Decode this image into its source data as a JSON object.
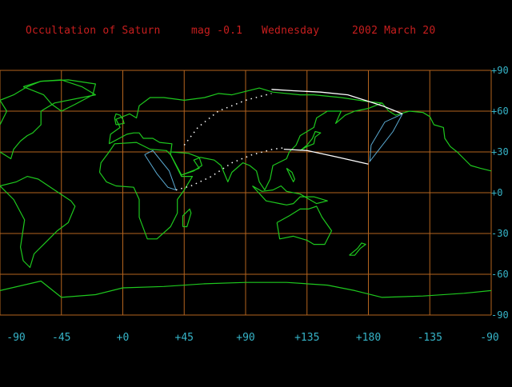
{
  "header": {
    "event": "Occultation of Saturn",
    "magnitude": "mag -0.1",
    "weekday": "Wednesday",
    "date": "2002 March 20"
  },
  "axes": {
    "lat_labels": [
      "+90",
      "+60",
      "+30",
      "+0",
      "-30",
      "-60",
      "-90"
    ],
    "lon_labels": [
      "-90",
      "-45",
      "+0",
      "+45",
      "+90",
      "+135",
      "+180",
      "-135",
      "-90"
    ]
  },
  "colors": {
    "background": "#000000",
    "grid": "#b4641e",
    "coast": "#1ec81e",
    "title": "#c81e1e",
    "labels": "#36b4c8",
    "path": "#ffffff",
    "region": "#5aaad2"
  },
  "map_data": {
    "projection": "equirectangular",
    "lon_range": [
      -90,
      270
    ],
    "lat_range": [
      -90,
      90
    ],
    "grid_step_lon": 45,
    "grid_step_lat": 30,
    "occultation_limits": {
      "northern_limit": [
        [
          109,
          76
        ],
        [
          125,
          75
        ],
        [
          145,
          74
        ],
        [
          165,
          72
        ],
        [
          190,
          64
        ],
        [
          205,
          58
        ]
      ],
      "southern_limit": [
        [
          118,
          32
        ],
        [
          135,
          31
        ],
        [
          158,
          26
        ],
        [
          180,
          21
        ]
      ],
      "night_portion": [
        [
          39,
          2
        ],
        [
          50,
          5
        ],
        [
          65,
          12
        ],
        [
          80,
          22
        ],
        [
          95,
          28
        ],
        [
          110,
          32
        ],
        [
          118,
          33
        ]
      ],
      "night_north": [
        [
          45,
          35
        ],
        [
          55,
          48
        ],
        [
          70,
          60
        ],
        [
          90,
          68
        ],
        [
          109,
          73
        ]
      ]
    },
    "visibility_region": [
      [
        205,
        58
      ],
      [
        198,
        45
      ],
      [
        188,
        32
      ],
      [
        181,
        23
      ],
      [
        182,
        35
      ],
      [
        192,
        52
      ],
      [
        205,
        58
      ]
    ],
    "west_region": [
      [
        16,
        28
      ],
      [
        25,
        14
      ],
      [
        33,
        4
      ],
      [
        39,
        2
      ],
      [
        34,
        16
      ],
      [
        22,
        31
      ],
      [
        16,
        28
      ]
    ],
    "land": {
      "north_america": [
        [
          -90,
          50
        ],
        [
          -85,
          60
        ],
        [
          -90,
          68
        ],
        [
          -80,
          72
        ],
        [
          -70,
          78
        ],
        [
          -60,
          82
        ],
        [
          -45,
          83
        ],
        [
          -30,
          78
        ],
        [
          -20,
          72
        ],
        [
          -50,
          66
        ],
        [
          -60,
          60
        ],
        [
          -60,
          50
        ],
        [
          -66,
          44
        ],
        [
          -70,
          42
        ],
        [
          -75,
          38
        ],
        [
          -80,
          32
        ],
        [
          -82,
          25
        ],
        [
          -90,
          30
        ]
      ],
      "greenland": [
        [
          -73,
          78
        ],
        [
          -60,
          82
        ],
        [
          -40,
          83
        ],
        [
          -20,
          80
        ],
        [
          -22,
          72
        ],
        [
          -35,
          65
        ],
        [
          -45,
          60
        ],
        [
          -52,
          65
        ],
        [
          -58,
          72
        ],
        [
          -73,
          78
        ]
      ],
      "south_america": [
        [
          -90,
          5
        ],
        [
          -78,
          8
        ],
        [
          -70,
          12
        ],
        [
          -62,
          10
        ],
        [
          -50,
          2
        ],
        [
          -38,
          -6
        ],
        [
          -35,
          -10
        ],
        [
          -40,
          -22
        ],
        [
          -48,
          -28
        ],
        [
          -58,
          -38
        ],
        [
          -65,
          -45
        ],
        [
          -68,
          -55
        ],
        [
          -73,
          -50
        ],
        [
          -75,
          -40
        ],
        [
          -72,
          -20
        ],
        [
          -80,
          -5
        ],
        [
          -90,
          5
        ]
      ],
      "africa": [
        [
          -17,
          15
        ],
        [
          -16,
          22
        ],
        [
          -10,
          30
        ],
        [
          -6,
          36
        ],
        [
          10,
          37
        ],
        [
          20,
          32
        ],
        [
          32,
          31
        ],
        [
          35,
          28
        ],
        [
          43,
          12
        ],
        [
          51,
          12
        ],
        [
          45,
          2
        ],
        [
          40,
          -5
        ],
        [
          40,
          -15
        ],
        [
          35,
          -25
        ],
        [
          25,
          -34
        ],
        [
          18,
          -34
        ],
        [
          12,
          -18
        ],
        [
          12,
          -5
        ],
        [
          8,
          4
        ],
        [
          -5,
          5
        ],
        [
          -12,
          8
        ],
        [
          -17,
          15
        ]
      ],
      "eurasia": [
        [
          -10,
          36
        ],
        [
          -9,
          43
        ],
        [
          -2,
          48
        ],
        [
          -5,
          54
        ],
        [
          5,
          58
        ],
        [
          10,
          55
        ],
        [
          12,
          64
        ],
        [
          20,
          70
        ],
        [
          30,
          70
        ],
        [
          45,
          68
        ],
        [
          60,
          70
        ],
        [
          70,
          73
        ],
        [
          80,
          72
        ],
        [
          100,
          77
        ],
        [
          110,
          74
        ],
        [
          130,
          72
        ],
        [
          140,
          72
        ],
        [
          160,
          70
        ],
        [
          180,
          67
        ],
        [
          190,
          66
        ],
        [
          180,
          62
        ],
        [
          170,
          60
        ],
        [
          163,
          57
        ],
        [
          156,
          51
        ],
        [
          160,
          60
        ],
        [
          150,
          60
        ],
        [
          142,
          55
        ],
        [
          140,
          48
        ],
        [
          130,
          42
        ],
        [
          127,
          35
        ],
        [
          122,
          30
        ],
        [
          120,
          25
        ],
        [
          110,
          20
        ],
        [
          108,
          10
        ],
        [
          104,
          2
        ],
        [
          100,
          8
        ],
        [
          98,
          16
        ],
        [
          93,
          20
        ],
        [
          88,
          22
        ],
        [
          80,
          15
        ],
        [
          77,
          8
        ],
        [
          72,
          20
        ],
        [
          67,
          24
        ],
        [
          57,
          26
        ],
        [
          52,
          24
        ],
        [
          56,
          18
        ],
        [
          43,
          13
        ],
        [
          35,
          28
        ],
        [
          36,
          36
        ],
        [
          27,
          37
        ],
        [
          22,
          40
        ],
        [
          15,
          40
        ],
        [
          12,
          44
        ],
        [
          8,
          44
        ],
        [
          3,
          43
        ],
        [
          -10,
          36
        ]
      ],
      "arabia_east": [
        [
          35,
          30
        ],
        [
          48,
          29
        ],
        [
          56,
          26
        ],
        [
          58,
          20
        ],
        [
          52,
          16
        ],
        [
          43,
          13
        ],
        [
          35,
          28
        ]
      ],
      "australia": [
        [
          113,
          -22
        ],
        [
          115,
          -34
        ],
        [
          125,
          -32
        ],
        [
          135,
          -35
        ],
        [
          140,
          -38
        ],
        [
          148,
          -38
        ],
        [
          153,
          -28
        ],
        [
          146,
          -18
        ],
        [
          142,
          -10
        ],
        [
          136,
          -12
        ],
        [
          130,
          -12
        ],
        [
          122,
          -17
        ],
        [
          113,
          -22
        ]
      ],
      "antarctica": [
        [
          -90,
          -72
        ],
        [
          -60,
          -65
        ],
        [
          -45,
          -77
        ],
        [
          -20,
          -75
        ],
        [
          0,
          -70
        ],
        [
          30,
          -69
        ],
        [
          60,
          -67
        ],
        [
          90,
          -66
        ],
        [
          120,
          -66
        ],
        [
          150,
          -68
        ],
        [
          170,
          -72
        ],
        [
          190,
          -77
        ],
        [
          220,
          -76
        ],
        [
          250,
          -74
        ],
        [
          270,
          -72
        ]
      ],
      "alaska_nw": [
        [
          190,
          66
        ],
        [
          195,
          60
        ],
        [
          200,
          57
        ],
        [
          210,
          60
        ],
        [
          220,
          59
        ],
        [
          225,
          56
        ],
        [
          228,
          50
        ],
        [
          235,
          48
        ],
        [
          236,
          40
        ],
        [
          240,
          34
        ],
        [
          245,
          30
        ],
        [
          250,
          25
        ],
        [
          255,
          20
        ],
        [
          262,
          18
        ],
        [
          270,
          16
        ]
      ],
      "japan": [
        [
          130,
          31
        ],
        [
          135,
          34
        ],
        [
          140,
          36
        ],
        [
          141,
          41
        ],
        [
          145,
          44
        ],
        [
          141,
          45
        ],
        [
          139,
          40
        ],
        [
          135,
          35
        ],
        [
          130,
          31
        ]
      ],
      "uk": [
        [
          -5,
          50
        ],
        [
          1,
          51
        ],
        [
          0,
          54
        ],
        [
          -2,
          57
        ],
        [
          -5,
          58
        ],
        [
          -6,
          55
        ],
        [
          -5,
          50
        ]
      ],
      "madagascar": [
        [
          44,
          -25
        ],
        [
          47,
          -25
        ],
        [
          50,
          -15
        ],
        [
          49,
          -12
        ],
        [
          44,
          -17
        ],
        [
          44,
          -25
        ]
      ],
      "indonesia": [
        [
          95,
          5
        ],
        [
          105,
          -6
        ],
        [
          115,
          -8
        ],
        [
          120,
          -9
        ],
        [
          125,
          -8
        ],
        [
          130,
          -3
        ],
        [
          140,
          -3
        ],
        [
          150,
          -6
        ],
        [
          142,
          -8
        ],
        [
          130,
          -1
        ],
        [
          120,
          1
        ],
        [
          116,
          5
        ],
        [
          110,
          2
        ],
        [
          102,
          1
        ],
        [
          95,
          5
        ]
      ],
      "new_zealand": [
        [
          166,
          -46
        ],
        [
          172,
          -41
        ],
        [
          175,
          -37
        ],
        [
          178,
          -38
        ],
        [
          174,
          -41
        ],
        [
          170,
          -46
        ],
        [
          166,
          -46
        ]
      ],
      "philippines": [
        [
          120,
          18
        ],
        [
          122,
          14
        ],
        [
          125,
          8
        ],
        [
          126,
          10
        ],
        [
          124,
          15
        ],
        [
          120,
          18
        ]
      ]
    }
  }
}
